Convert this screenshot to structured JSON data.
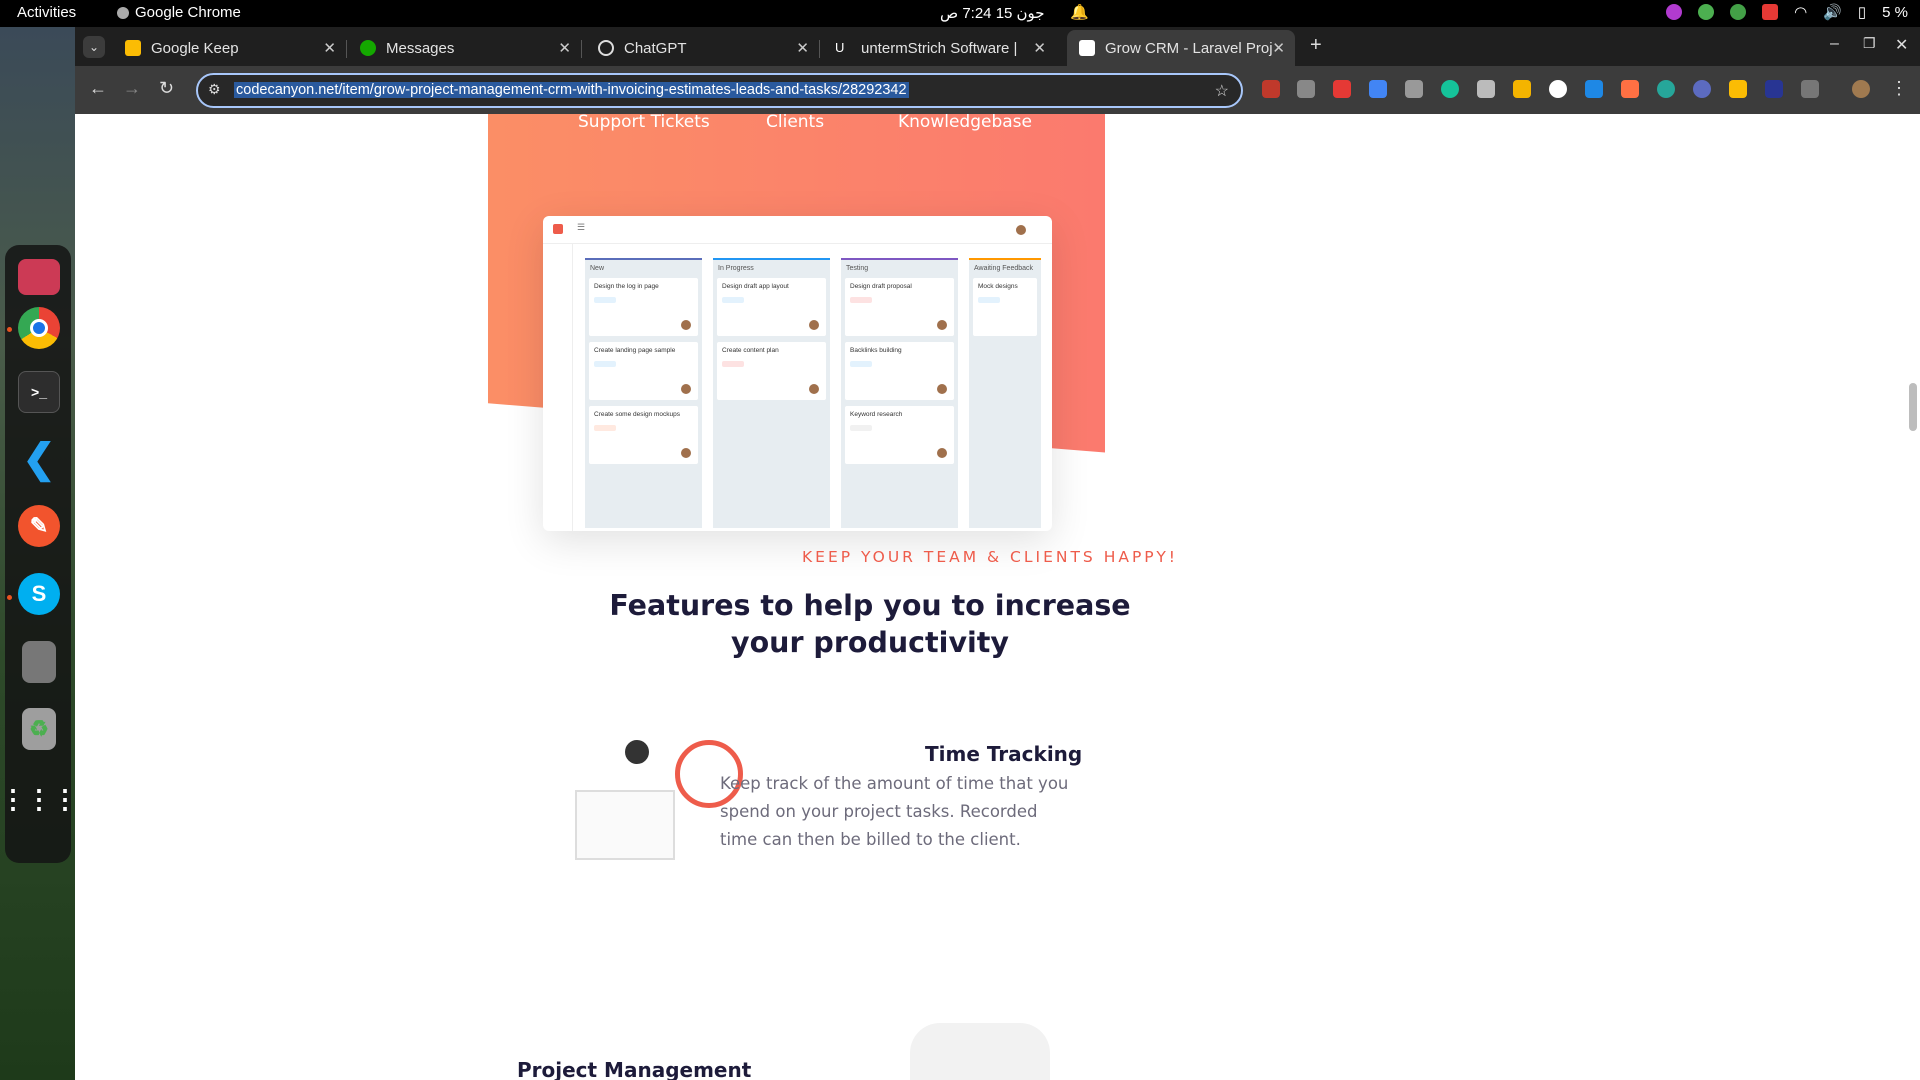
{
  "topbar": {
    "activities": "Activities",
    "app_name": "Google Chrome",
    "clock": "جون 15  7:24 ص",
    "battery": "5 %"
  },
  "tabs": [
    {
      "title": "Google Keep",
      "favicon_color": "#fbbc04"
    },
    {
      "title": "Messages",
      "favicon_color": "#14a800"
    },
    {
      "title": "ChatGPT",
      "favicon_color": "#ffffff"
    },
    {
      "title": "untermStrich Software |",
      "favicon_color": "#ffffff"
    },
    {
      "title": "Grow CRM - Laravel Proj",
      "favicon_color": "#ffffff",
      "active": true
    }
  ],
  "omnibox": {
    "url": "codecanyon.net/item/grow-project-management-crm-with-invoicing-estimates-leads-and-tasks/28292342"
  },
  "hero_nav": [
    "Support Tickets",
    "Clients",
    "Knowledgebase"
  ],
  "kanban": {
    "columns": [
      {
        "name": "New",
        "color": "#5a6dba",
        "cards": [
          {
            "title": "Design the log in page",
            "badge": "normal",
            "badge_color": "#e3f2fd"
          },
          {
            "title": "Create landing page sample",
            "badge": "normal",
            "badge_color": "#e3f2fd"
          },
          {
            "title": "Create some design mockups",
            "badge": "high",
            "badge_color": "#ffe9e0"
          }
        ]
      },
      {
        "name": "In Progress",
        "color": "#2196f3",
        "cards": [
          {
            "title": "Design draft app layout",
            "badge": "normal",
            "badge_color": "#e3f2fd"
          },
          {
            "title": "Create content plan",
            "badge": "Urgent",
            "badge_color": "#fde2e2"
          }
        ]
      },
      {
        "name": "Testing",
        "color": "#7e57c2",
        "cards": [
          {
            "title": "Design draft proposal",
            "badge": "Urgent",
            "badge_color": "#fde2e2"
          },
          {
            "title": "Backlinks building",
            "badge": "normal",
            "badge_color": "#e3f2fd"
          },
          {
            "title": "Keyword research",
            "badge": "low",
            "badge_color": "#f1f1f1"
          }
        ]
      },
      {
        "name": "Awaiting Feedback",
        "color": "#ff9800",
        "cards": [
          {
            "title": "Mock designs",
            "badge": "normal",
            "badge_color": "#e3f2fd"
          }
        ]
      }
    ]
  },
  "section": {
    "eyebrow": "KEEP YOUR TEAM & CLIENTS HAPPY!",
    "heading": "Features to help you to increase your productivity"
  },
  "features": [
    {
      "title": "Time Tracking",
      "description": "Keep track of the amount of time that you spend on your project tasks. Recorded time can then be billed to the client."
    },
    {
      "title": "Project Management"
    }
  ],
  "colors": {
    "accent": "#ee5c4b",
    "hero_start": "#fb8e66",
    "hero_end": "#fb7a6e"
  }
}
